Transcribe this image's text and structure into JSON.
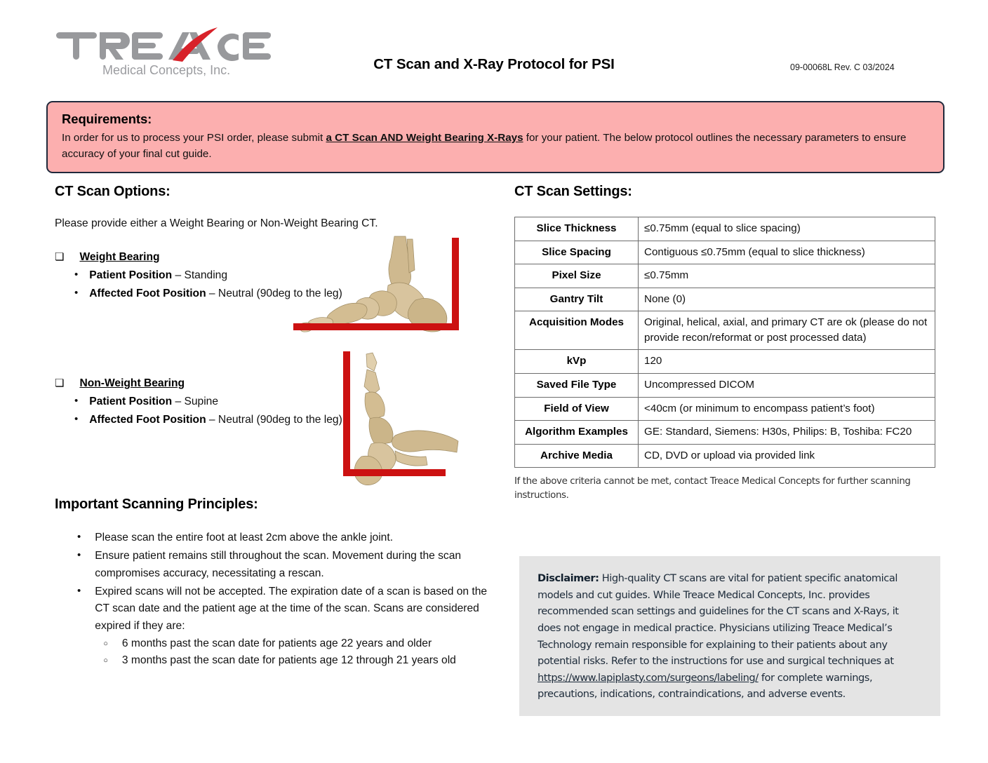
{
  "header": {
    "logo_main": "TREACE",
    "logo_sub": "Medical Concepts, Inc.",
    "title": "CT Scan and X-Ray Protocol for PSI",
    "doc_code": "09-00068L Rev. C 03/2024"
  },
  "requirements": {
    "title": "Requirements:",
    "text_before": "In order for us to process your PSI order, please submit ",
    "emphasis": "a CT Scan AND Weight Bearing X-Rays",
    "text_after": " for your patient. The below protocol outlines the necessary parameters to ensure accuracy of your final cut guide.",
    "bg_color": "#FCAFAF",
    "border_color": "#20293b"
  },
  "ct_scan_options": {
    "heading": "CT Scan Options:",
    "lead": "Please provide either a Weight Bearing or Non-Weight Bearing CT.",
    "checkbox_glyph": "❏",
    "bullet_glyph": "•",
    "options": [
      {
        "title": "Weight Bearing",
        "items": [
          {
            "label": "Patient Position",
            "value": " – Standing"
          },
          {
            "label": "Affected Foot Position",
            "value": " – Neutral (90deg to the leg)"
          }
        ]
      },
      {
        "title": "Non-Weight Bearing",
        "items": [
          {
            "label": "Patient Position",
            "value": " – Supine"
          },
          {
            "label": "Affected Foot Position",
            "value": " – Neutral (90deg to the leg)"
          }
        ]
      }
    ],
    "images": [
      {
        "name": "weight-bearing-foot-diagram",
        "alt": "Lateral skeletal foot on red horizontal floor line with vertical red reference line",
        "marker_color": "#cc1111"
      },
      {
        "name": "non-weight-bearing-foot-diagram",
        "alt": "Rotated skeletal foot with red vertical and horizontal reference lines",
        "marker_color": "#cc1111"
      }
    ]
  },
  "principles": {
    "heading": "Important Scanning Principles:",
    "bullet_glyph": "•",
    "subbullet_glyph": "○",
    "items": [
      {
        "text": "Please scan the entire foot at least 2cm above the ankle joint."
      },
      {
        "text": "Ensure patient remains still throughout the scan. Movement during the scan compromises accuracy, necessitating a rescan."
      },
      {
        "text": "Expired scans will not be accepted. The expiration date of a scan is based on the CT scan date and the patient age at the time of the scan. Scans are considered expired if they are:",
        "subitems": [
          "6 months past the scan date for patients age 22 years and older",
          "3 months past the scan date for patients age 12 through 21 years old"
        ]
      }
    ]
  },
  "ct_scan_settings": {
    "heading": "CT Scan Settings:",
    "rows": [
      {
        "key": "Slice Thickness",
        "value": "≤0.75mm (equal to slice spacing)"
      },
      {
        "key": "Slice Spacing",
        "value": "Contiguous ≤0.75mm (equal to slice thickness)"
      },
      {
        "key": "Pixel Size",
        "value": "≤0.75mm"
      },
      {
        "key": "Gantry Tilt",
        "value": "None (0)"
      },
      {
        "key": "Acquisition Modes",
        "value": "Original, helical, axial, and primary CT are ok (please do not provide recon/reformat or post processed data)"
      },
      {
        "key": "kVp",
        "value": "120"
      },
      {
        "key": "Saved File Type",
        "value": "Uncompressed DICOM"
      },
      {
        "key": "Field of View",
        "value": "<40cm (or minimum to encompass patient’s foot)"
      },
      {
        "key": "Algorithm Examples",
        "value": "GE: Standard, Siemens: H30s, Philips: B, Toshiba: FC20"
      },
      {
        "key": "Archive Media",
        "value": "CD, DVD or upload via provided link"
      }
    ],
    "note": "If the above criteria cannot be met, contact Treace Medical Concepts for further scanning instructions."
  },
  "disclaimer": {
    "label": "Disclaimer:",
    "text_before": " High-quality CT scans are vital for patient specific anatomical models and cut guides. While Treace Medical Concepts, Inc. provides recommended scan settings and guidelines for the CT scans and X-Rays, it does not engage in medical practice. Physicians utilizing Treace Medical’s Technology remain responsible for explaining to their patients about any potential risks. Refer to the instructions for use and surgical techniques at ",
    "link": "https://www.lapiplasty.com/surgeons/labeling/",
    "text_after": " for complete warnings, precautions, indications, contraindications, and adverse events.",
    "bg_color": "#E4E4E4"
  }
}
